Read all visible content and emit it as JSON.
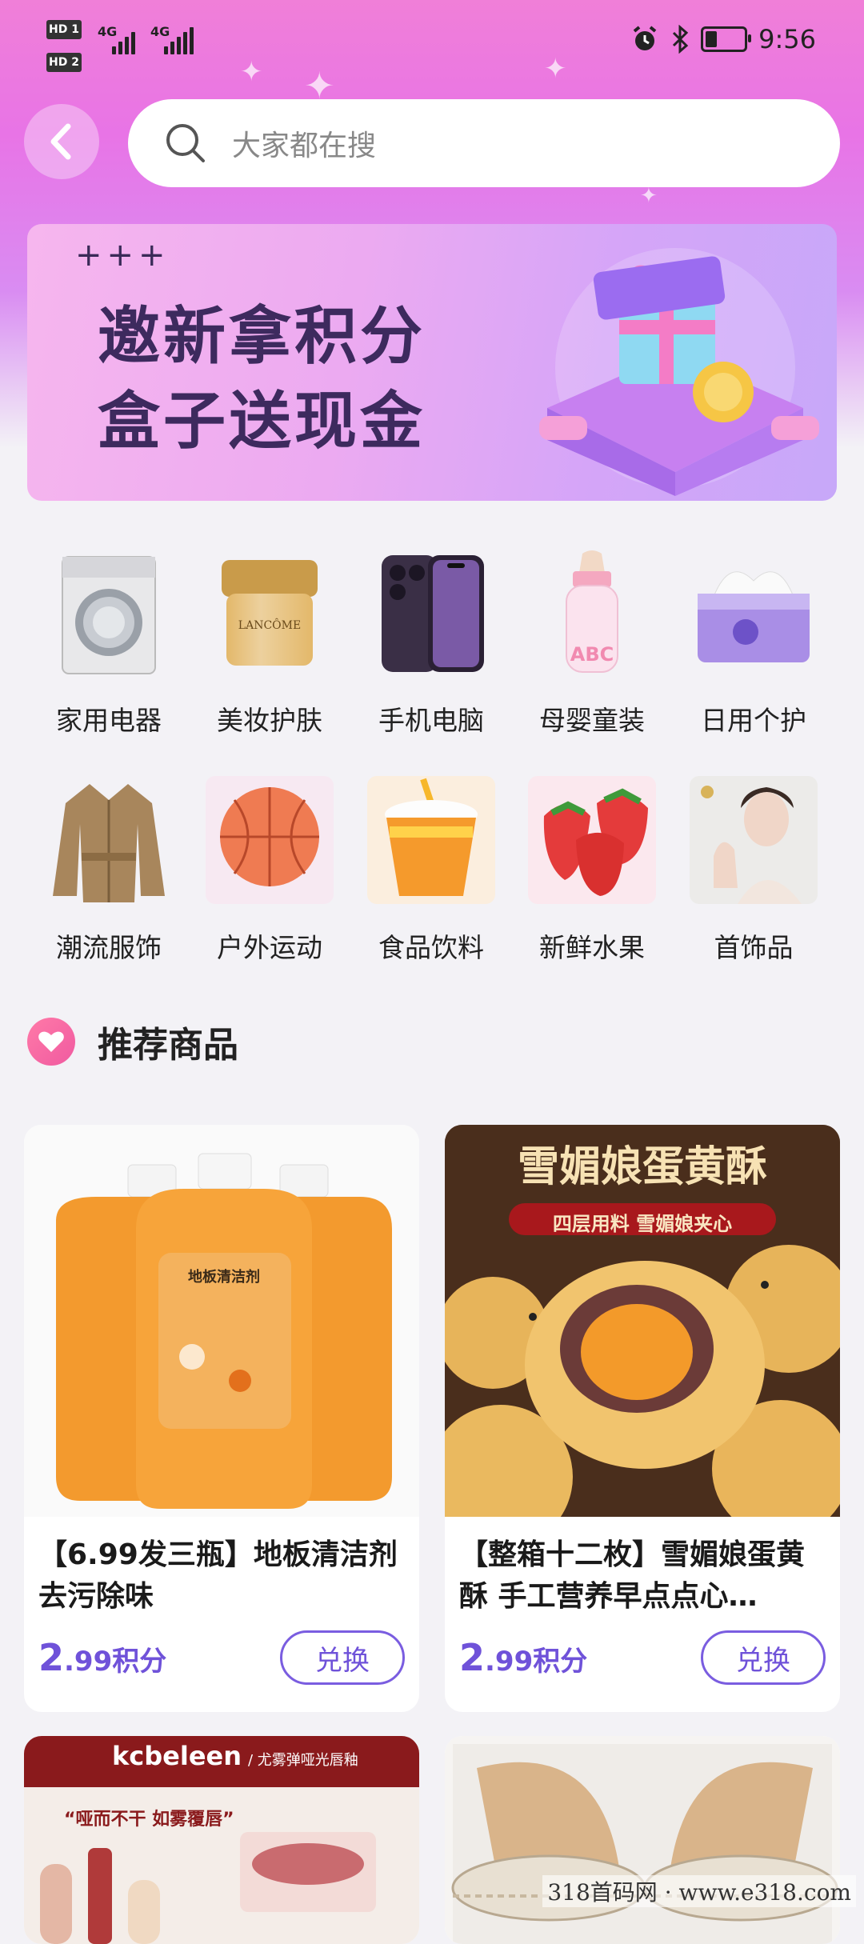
{
  "status_bar": {
    "hd1": "HD 1",
    "hd2": "HD 2",
    "net1": "4G",
    "net2": "4G",
    "time": "9:56",
    "battery_level": 0.3
  },
  "search": {
    "placeholder": "大家都在搜"
  },
  "banner": {
    "plus": "+++",
    "line1": "邀新拿积分",
    "line2": "盒子送现金"
  },
  "categories": [
    {
      "label": "家用电器",
      "icon": "washing-machine-icon"
    },
    {
      "label": "美妆护肤",
      "icon": "cream-jar-icon"
    },
    {
      "label": "手机电脑",
      "icon": "phone-icon"
    },
    {
      "label": "母婴童装",
      "icon": "baby-bottle-icon"
    },
    {
      "label": "日用个护",
      "icon": "tissue-box-icon"
    },
    {
      "label": "潮流服饰",
      "icon": "coat-icon"
    },
    {
      "label": "户外运动",
      "icon": "basketball-icon"
    },
    {
      "label": "食品饮料",
      "icon": "drink-cup-icon"
    },
    {
      "label": "新鲜水果",
      "icon": "strawberry-icon"
    },
    {
      "label": "首饰品",
      "icon": "jewelry-model-icon"
    }
  ],
  "section": {
    "title": "推荐商品"
  },
  "products": [
    {
      "title": "【6.99发三瓶】地板清洁剂去污除味",
      "price_int": "2",
      "price_rest": ".99积分",
      "button": "兑换",
      "image_label": "地板清洁剂"
    },
    {
      "title": "【整箱十二枚】雪媚娘蛋黄酥 手工营养早点点心…",
      "price_int": "2",
      "price_rest": ".99积分",
      "button": "兑换",
      "image_heading": "雪媚娘蛋黄酥",
      "image_sub": "四层用料 雪媚娘夹心"
    },
    {
      "brand": "kcbeleen",
      "brand_sub": "/ 尤雾弹哑光唇釉",
      "slogan": "“哑而不干 如雾覆唇”"
    },
    {}
  ],
  "watermark": "318首码网 · www.e318.com",
  "colors": {
    "accent": "#6f52d9",
    "top_gradient": "#e874e6"
  }
}
